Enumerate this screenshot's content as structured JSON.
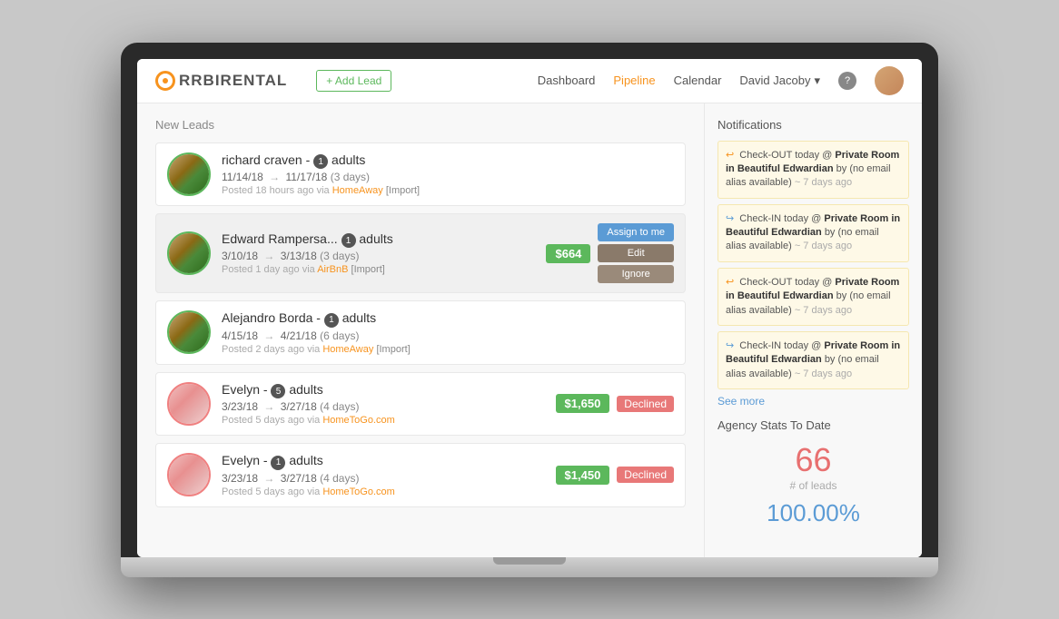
{
  "navbar": {
    "logo_text": "RBIRENTAL",
    "add_lead": "+ Add Lead",
    "links": [
      {
        "label": "Dashboard",
        "active": false
      },
      {
        "label": "Pipeline",
        "active": true
      },
      {
        "label": "Calendar",
        "active": false
      }
    ],
    "user": "David Jacoby",
    "help": "?"
  },
  "leads_section": {
    "title": "New Leads",
    "leads": [
      {
        "id": 1,
        "name": "richard craven -",
        "adults": "1",
        "adults_label": "adults",
        "date_from": "11/14/18",
        "date_to": "11/17/18",
        "days": "3 days",
        "posted": "18 hours ago",
        "source": "HomeAway",
        "import_label": "[Import]",
        "price": null,
        "status": null,
        "avatar_type": "room"
      },
      {
        "id": 2,
        "name": "Edward Rampersa...",
        "adults": "1",
        "adults_label": "adults",
        "date_from": "3/10/18",
        "date_to": "3/13/18",
        "days": "3 days",
        "posted": "1 day ago",
        "source": "AirBnB",
        "import_label": "[Import]",
        "price": "$664",
        "status": null,
        "avatar_type": "room",
        "has_actions": true
      },
      {
        "id": 3,
        "name": "Alejandro Borda -",
        "adults": "1",
        "adults_label": "adults",
        "date_from": "4/15/18",
        "date_to": "4/21/18",
        "days": "6 days",
        "posted": "2 days ago",
        "source": "HomeAway",
        "import_label": "[Import]",
        "price": null,
        "status": null,
        "avatar_type": "room"
      },
      {
        "id": 4,
        "name": "Evelyn -",
        "adults": "5",
        "adults_label": "adults",
        "date_from": "3/23/18",
        "date_to": "3/27/18",
        "days": "4 days",
        "posted": "5 days ago",
        "source": "HomeToGo.com",
        "import_label": "",
        "price": "$1,650",
        "status": "Declined",
        "avatar_type": "pink"
      },
      {
        "id": 5,
        "name": "Evelyn -",
        "adults": "1",
        "adults_label": "adults",
        "date_from": "3/23/18",
        "date_to": "3/27/18",
        "days": "4 days",
        "posted": "5 days ago",
        "source": "HomeToGo.com",
        "import_label": "",
        "price": "$1,450",
        "status": "Declined",
        "avatar_type": "pink"
      }
    ],
    "buttons": {
      "assign": "Assign to me",
      "edit": "Edit",
      "ignore": "Ignore"
    }
  },
  "notifications": {
    "title": "Notifications",
    "items": [
      {
        "type": "checkout",
        "text": "Check-OUT today @",
        "property": "Private Room in Beautiful Edwardian",
        "by": "by (no email alias available)",
        "time": "~ 7 days ago"
      },
      {
        "type": "checkin",
        "text": "Check-IN today @",
        "property": "Private Room in Beautiful Edwardian",
        "by": "by (no email alias available)",
        "time": "~ 7 days ago"
      },
      {
        "type": "checkout",
        "text": "Check-OUT today @",
        "property": "Private Room in Beautiful Edwardian",
        "by": "by (no email alias available)",
        "time": "~ 7 days ago"
      },
      {
        "type": "checkin",
        "text": "Check-IN today @",
        "property": "Private Room in Beautiful Edwardian",
        "by": "by (no email alias available)",
        "time": "~ 7 days ago"
      }
    ],
    "see_more": "See more"
  },
  "agency_stats": {
    "title": "Agency Stats To Date",
    "leads_count": "66",
    "leads_label": "# of leads",
    "conversion": "100.00%"
  }
}
